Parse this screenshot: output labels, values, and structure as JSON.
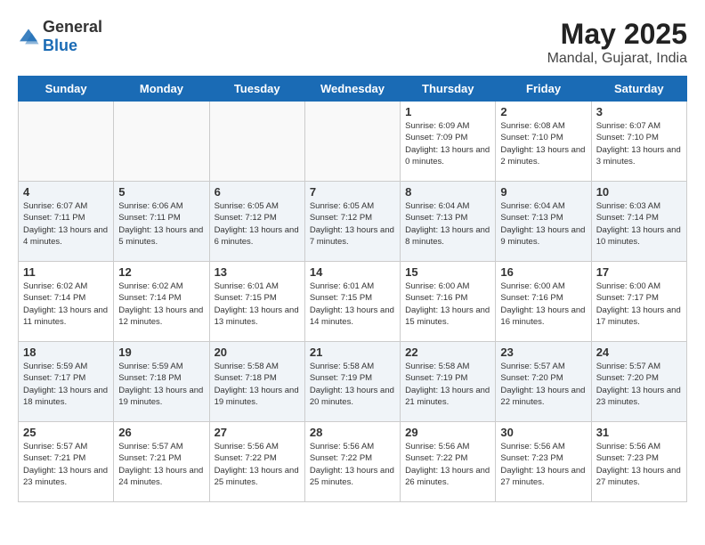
{
  "header": {
    "logo_general": "General",
    "logo_blue": "Blue",
    "title": "May 2025",
    "location": "Mandal, Gujarat, India"
  },
  "days_of_week": [
    "Sunday",
    "Monday",
    "Tuesday",
    "Wednesday",
    "Thursday",
    "Friday",
    "Saturday"
  ],
  "weeks": [
    [
      {
        "day": "",
        "info": ""
      },
      {
        "day": "",
        "info": ""
      },
      {
        "day": "",
        "info": ""
      },
      {
        "day": "",
        "info": ""
      },
      {
        "day": "1",
        "info": "Sunrise: 6:09 AM\nSunset: 7:09 PM\nDaylight: 13 hours and 0 minutes."
      },
      {
        "day": "2",
        "info": "Sunrise: 6:08 AM\nSunset: 7:10 PM\nDaylight: 13 hours and 2 minutes."
      },
      {
        "day": "3",
        "info": "Sunrise: 6:07 AM\nSunset: 7:10 PM\nDaylight: 13 hours and 3 minutes."
      }
    ],
    [
      {
        "day": "4",
        "info": "Sunrise: 6:07 AM\nSunset: 7:11 PM\nDaylight: 13 hours and 4 minutes."
      },
      {
        "day": "5",
        "info": "Sunrise: 6:06 AM\nSunset: 7:11 PM\nDaylight: 13 hours and 5 minutes."
      },
      {
        "day": "6",
        "info": "Sunrise: 6:05 AM\nSunset: 7:12 PM\nDaylight: 13 hours and 6 minutes."
      },
      {
        "day": "7",
        "info": "Sunrise: 6:05 AM\nSunset: 7:12 PM\nDaylight: 13 hours and 7 minutes."
      },
      {
        "day": "8",
        "info": "Sunrise: 6:04 AM\nSunset: 7:13 PM\nDaylight: 13 hours and 8 minutes."
      },
      {
        "day": "9",
        "info": "Sunrise: 6:04 AM\nSunset: 7:13 PM\nDaylight: 13 hours and 9 minutes."
      },
      {
        "day": "10",
        "info": "Sunrise: 6:03 AM\nSunset: 7:14 PM\nDaylight: 13 hours and 10 minutes."
      }
    ],
    [
      {
        "day": "11",
        "info": "Sunrise: 6:02 AM\nSunset: 7:14 PM\nDaylight: 13 hours and 11 minutes."
      },
      {
        "day": "12",
        "info": "Sunrise: 6:02 AM\nSunset: 7:14 PM\nDaylight: 13 hours and 12 minutes."
      },
      {
        "day": "13",
        "info": "Sunrise: 6:01 AM\nSunset: 7:15 PM\nDaylight: 13 hours and 13 minutes."
      },
      {
        "day": "14",
        "info": "Sunrise: 6:01 AM\nSunset: 7:15 PM\nDaylight: 13 hours and 14 minutes."
      },
      {
        "day": "15",
        "info": "Sunrise: 6:00 AM\nSunset: 7:16 PM\nDaylight: 13 hours and 15 minutes."
      },
      {
        "day": "16",
        "info": "Sunrise: 6:00 AM\nSunset: 7:16 PM\nDaylight: 13 hours and 16 minutes."
      },
      {
        "day": "17",
        "info": "Sunrise: 6:00 AM\nSunset: 7:17 PM\nDaylight: 13 hours and 17 minutes."
      }
    ],
    [
      {
        "day": "18",
        "info": "Sunrise: 5:59 AM\nSunset: 7:17 PM\nDaylight: 13 hours and 18 minutes."
      },
      {
        "day": "19",
        "info": "Sunrise: 5:59 AM\nSunset: 7:18 PM\nDaylight: 13 hours and 19 minutes."
      },
      {
        "day": "20",
        "info": "Sunrise: 5:58 AM\nSunset: 7:18 PM\nDaylight: 13 hours and 19 minutes."
      },
      {
        "day": "21",
        "info": "Sunrise: 5:58 AM\nSunset: 7:19 PM\nDaylight: 13 hours and 20 minutes."
      },
      {
        "day": "22",
        "info": "Sunrise: 5:58 AM\nSunset: 7:19 PM\nDaylight: 13 hours and 21 minutes."
      },
      {
        "day": "23",
        "info": "Sunrise: 5:57 AM\nSunset: 7:20 PM\nDaylight: 13 hours and 22 minutes."
      },
      {
        "day": "24",
        "info": "Sunrise: 5:57 AM\nSunset: 7:20 PM\nDaylight: 13 hours and 23 minutes."
      }
    ],
    [
      {
        "day": "25",
        "info": "Sunrise: 5:57 AM\nSunset: 7:21 PM\nDaylight: 13 hours and 23 minutes."
      },
      {
        "day": "26",
        "info": "Sunrise: 5:57 AM\nSunset: 7:21 PM\nDaylight: 13 hours and 24 minutes."
      },
      {
        "day": "27",
        "info": "Sunrise: 5:56 AM\nSunset: 7:22 PM\nDaylight: 13 hours and 25 minutes."
      },
      {
        "day": "28",
        "info": "Sunrise: 5:56 AM\nSunset: 7:22 PM\nDaylight: 13 hours and 25 minutes."
      },
      {
        "day": "29",
        "info": "Sunrise: 5:56 AM\nSunset: 7:22 PM\nDaylight: 13 hours and 26 minutes."
      },
      {
        "day": "30",
        "info": "Sunrise: 5:56 AM\nSunset: 7:23 PM\nDaylight: 13 hours and 27 minutes."
      },
      {
        "day": "31",
        "info": "Sunrise: 5:56 AM\nSunset: 7:23 PM\nDaylight: 13 hours and 27 minutes."
      }
    ]
  ]
}
